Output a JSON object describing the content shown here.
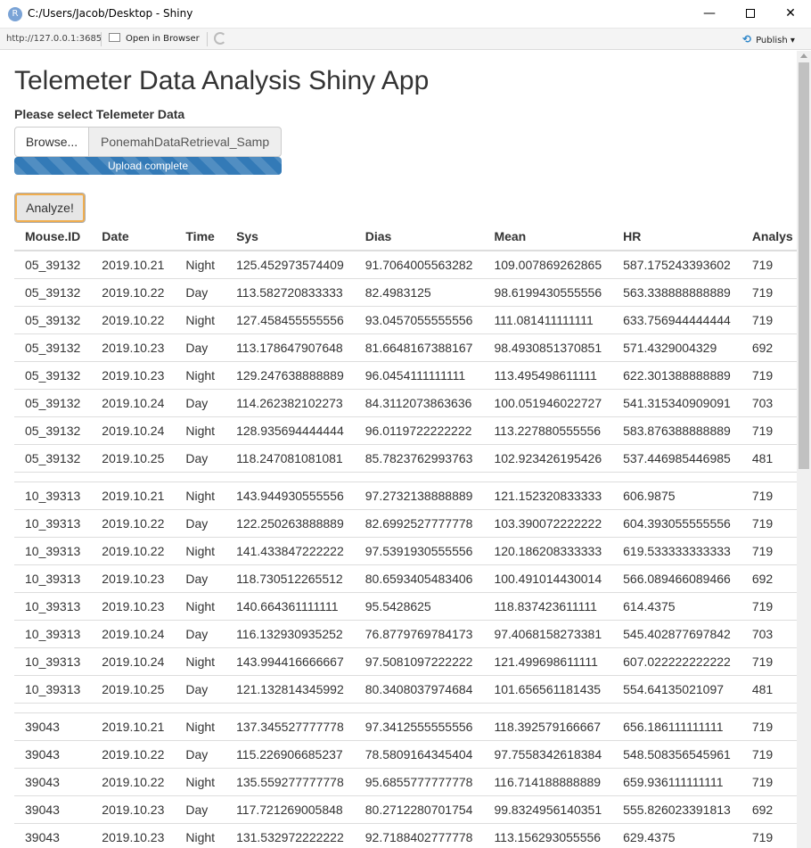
{
  "window": {
    "title": "C:/Users/Jacob/Desktop - Shiny",
    "app_icon_letter": "R",
    "minimize_glyph": "—",
    "close_glyph": "✕"
  },
  "toolbar": {
    "url": "http://127.0.0.1:3685",
    "open_in_browser": "Open in Browser",
    "publish": "Publish",
    "publish_caret": "▾"
  },
  "app": {
    "title": "Telemeter Data Analysis Shiny App",
    "file_label": "Please select Telemeter Data",
    "browse_label": "Browse...",
    "file_name": "PonemahDataRetrieval_Samp",
    "upload_status": "Upload complete",
    "upload_progress_pct": 100,
    "analyze_label": "Analyze!"
  },
  "table": {
    "headers": [
      "Mouse.ID",
      "Date",
      "Time",
      "Sys",
      "Dias",
      "Mean",
      "HR",
      "Analys"
    ],
    "groups": [
      [
        [
          "05_39132",
          "2019.10.21",
          "Night",
          "125.452973574409",
          "91.7064005563282",
          "109.007869262865",
          "587.175243393602",
          "719"
        ],
        [
          "05_39132",
          "2019.10.22",
          "Day",
          "113.582720833333",
          "82.4983125",
          "98.6199430555556",
          "563.338888888889",
          "719"
        ],
        [
          "05_39132",
          "2019.10.22",
          "Night",
          "127.458455555556",
          "93.0457055555556",
          "111.081411111111",
          "633.756944444444",
          "719"
        ],
        [
          "05_39132",
          "2019.10.23",
          "Day",
          "113.178647907648",
          "81.6648167388167",
          "98.4930851370851",
          "571.4329004329",
          "692"
        ],
        [
          "05_39132",
          "2019.10.23",
          "Night",
          "129.247638888889",
          "96.0454111111111",
          "113.495498611111",
          "622.301388888889",
          "719"
        ],
        [
          "05_39132",
          "2019.10.24",
          "Day",
          "114.262382102273",
          "84.3112073863636",
          "100.051946022727",
          "541.315340909091",
          "703"
        ],
        [
          "05_39132",
          "2019.10.24",
          "Night",
          "128.935694444444",
          "96.0119722222222",
          "113.227880555556",
          "583.876388888889",
          "719"
        ],
        [
          "05_39132",
          "2019.10.25",
          "Day",
          "118.247081081081",
          "85.7823762993763",
          "102.923426195426",
          "537.446985446985",
          "481"
        ]
      ],
      [
        [
          "10_39313",
          "2019.10.21",
          "Night",
          "143.944930555556",
          "97.2732138888889",
          "121.152320833333",
          "606.9875",
          "719"
        ],
        [
          "10_39313",
          "2019.10.22",
          "Day",
          "122.250263888889",
          "82.6992527777778",
          "103.390072222222",
          "604.393055555556",
          "719"
        ],
        [
          "10_39313",
          "2019.10.22",
          "Night",
          "141.433847222222",
          "97.5391930555556",
          "120.186208333333",
          "619.533333333333",
          "719"
        ],
        [
          "10_39313",
          "2019.10.23",
          "Day",
          "118.730512265512",
          "80.6593405483406",
          "100.491014430014",
          "566.089466089466",
          "692"
        ],
        [
          "10_39313",
          "2019.10.23",
          "Night",
          "140.664361111111",
          "95.5428625",
          "118.837423611111",
          "614.4375",
          "719"
        ],
        [
          "10_39313",
          "2019.10.24",
          "Day",
          "116.132930935252",
          "76.8779769784173",
          "97.4068158273381",
          "545.402877697842",
          "703"
        ],
        [
          "10_39313",
          "2019.10.24",
          "Night",
          "143.994416666667",
          "97.5081097222222",
          "121.499698611111",
          "607.022222222222",
          "719"
        ],
        [
          "10_39313",
          "2019.10.25",
          "Day",
          "121.132814345992",
          "80.3408037974684",
          "101.656561181435",
          "554.64135021097",
          "481"
        ]
      ],
      [
        [
          "39043",
          "2019.10.21",
          "Night",
          "137.345527777778",
          "97.3412555555556",
          "118.392579166667",
          "656.186111111111",
          "719"
        ],
        [
          "39043",
          "2019.10.22",
          "Day",
          "115.226906685237",
          "78.5809164345404",
          "97.7558342618384",
          "548.508356545961",
          "719"
        ],
        [
          "39043",
          "2019.10.22",
          "Night",
          "135.559277777778",
          "95.6855777777778",
          "116.714188888889",
          "659.936111111111",
          "719"
        ],
        [
          "39043",
          "2019.10.23",
          "Day",
          "117.721269005848",
          "80.2712280701754",
          "99.8324956140351",
          "555.826023391813",
          "692"
        ],
        [
          "39043",
          "2019.10.23",
          "Night",
          "131.532972222222",
          "92.7188402777778",
          "113.156293055556",
          "629.4375",
          "719"
        ]
      ]
    ]
  },
  "colors": {
    "progress_bar": "#337ab7",
    "analyze_focus": "#f0ad4e",
    "publish_icon": "#2d86c9"
  }
}
